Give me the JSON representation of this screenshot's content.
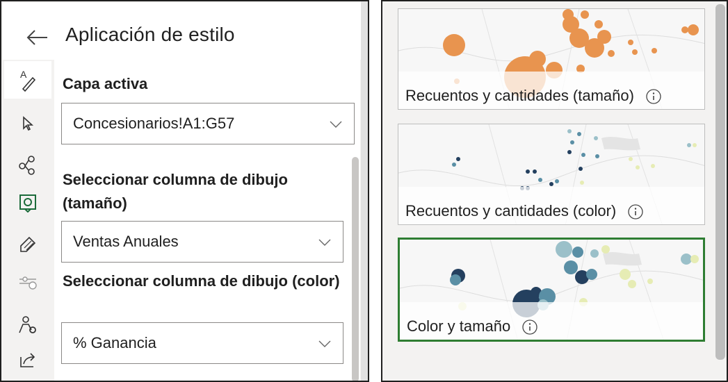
{
  "panel": {
    "title": "Aplicación de estilo",
    "active_layer_label": "Capa activa",
    "active_layer_value": "Concesionarios!A1:G57",
    "size_column_label": "Seleccionar columna de dibujo (tamaño)",
    "size_column_value": "Ventas Anuales",
    "color_column_label": "Seleccionar columna de dibujo (color)",
    "color_column_value": "% Ganancia"
  },
  "rail_icons": [
    "style-icon",
    "cursor-icon",
    "nodes-icon",
    "gear-shield-icon",
    "tag-icon",
    "time-slider-icon",
    "person-settings-icon",
    "share-icon"
  ],
  "cards": [
    {
      "label": "Recuentos y cantidades (tamaño)",
      "selected": false
    },
    {
      "label": "Recuentos y cantidades (color)",
      "selected": false
    },
    {
      "label": "Color y tamaño",
      "selected": true
    }
  ],
  "colors": {
    "accent_green": "#2e7d32",
    "orange": "#e8944f",
    "dark_blue": "#24405f",
    "teal": "#5a8fa5",
    "light_yellow": "#e6ecb4"
  }
}
